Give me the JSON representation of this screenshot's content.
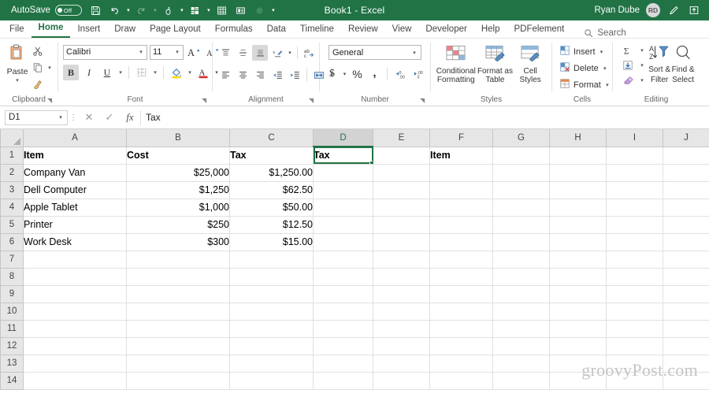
{
  "titlebar": {
    "autosave_label": "AutoSave",
    "autosave_state": "Off",
    "document_title": "Book1  -  Excel",
    "user_name": "Ryan Dube",
    "avatar_initials": "RD",
    "quick_access": [
      {
        "name": "save-icon",
        "label": "Save"
      },
      {
        "name": "undo-icon",
        "label": "Undo"
      },
      {
        "name": "redo-icon",
        "label": "Redo"
      },
      {
        "name": "touch-mode-icon",
        "label": "Touch/Mouse Mode"
      },
      {
        "name": "sort-filter-icon",
        "label": "Sort and Filter"
      },
      {
        "name": "table-icon",
        "label": "Table"
      },
      {
        "name": "form-icon",
        "label": "Form"
      },
      {
        "name": "record-icon",
        "label": "Record"
      },
      {
        "name": "customize-qat-icon",
        "label": "Customize Quick Access Toolbar"
      }
    ],
    "ribbon_display_icon": "ribbon-display-options-icon",
    "pen_icon": "pen-icon"
  },
  "tabs": [
    {
      "label": "File",
      "active": false
    },
    {
      "label": "Home",
      "active": true
    },
    {
      "label": "Insert",
      "active": false
    },
    {
      "label": "Draw",
      "active": false
    },
    {
      "label": "Page Layout",
      "active": false
    },
    {
      "label": "Formulas",
      "active": false
    },
    {
      "label": "Data",
      "active": false
    },
    {
      "label": "Timeline",
      "active": false
    },
    {
      "label": "Review",
      "active": false
    },
    {
      "label": "View",
      "active": false
    },
    {
      "label": "Developer",
      "active": false
    },
    {
      "label": "Help",
      "active": false
    },
    {
      "label": "PDFelement",
      "active": false
    }
  ],
  "search": {
    "placeholder": "Search",
    "label": "Search"
  },
  "ribbon": {
    "clipboard": {
      "group_label": "Clipboard",
      "paste_label": "Paste",
      "cut_label": "Cut",
      "copy_label": "Copy",
      "format_painter_label": "Format Painter"
    },
    "font": {
      "group_label": "Font",
      "font_name": "Calibri",
      "font_size": "11",
      "grow_label": "Increase Font Size",
      "shrink_label": "Decrease Font Size",
      "bold_label": "B",
      "italic_label": "I",
      "underline_label": "U",
      "borders_label": "Borders",
      "fill_label": "Fill Color",
      "fontcolor_label": "Font Color"
    },
    "alignment": {
      "group_label": "Alignment",
      "top_align_label": "Top Align",
      "middle_align_label": "Middle Align",
      "bottom_align_label": "Bottom Align",
      "orientation_label": "Orientation",
      "align_left_label": "Align Left",
      "align_center_label": "Center",
      "align_right_label": "Align Right",
      "decrease_indent_label": "Decrease Indent",
      "increase_indent_label": "Increase Indent",
      "wrap_text_label": "Wrap Text",
      "merge_label": "Merge & Center"
    },
    "number": {
      "group_label": "Number",
      "format_value": "General",
      "currency_label": "$",
      "percent_label": "%",
      "comma_label": ",",
      "increase_decimal_label": "Increase Decimal",
      "decrease_decimal_label": "Decrease Decimal"
    },
    "styles": {
      "group_label": "Styles",
      "conditional_formatting_label": "Conditional Formatting",
      "format_as_table_label": "Format as Table",
      "cell_styles_label": "Cell Styles"
    },
    "cells": {
      "group_label": "Cells",
      "insert_label": "Insert",
      "delete_label": "Delete",
      "format_label": "Format"
    },
    "editing": {
      "group_label": "Editing",
      "autosum_label": "AutoSum",
      "fill_label": "Fill",
      "clear_label": "Clear",
      "sort_filter_label": "Sort &\nFilter",
      "sort_filter_line1": "Sort &",
      "sort_filter_line2": "Filter",
      "find_select_line1": "Find &",
      "find_select_line2": "Select"
    }
  },
  "formula_bar": {
    "name_box_value": "D1",
    "cancel_label": "Cancel",
    "enter_label": "Enter",
    "fx_label": "fx",
    "formula_value": "Tax"
  },
  "grid": {
    "columns": [
      "A",
      "B",
      "C",
      "D",
      "E",
      "F",
      "G",
      "H",
      "I",
      "J"
    ],
    "selected_column": "D",
    "selected_cell": "D1",
    "rows": [
      1,
      2,
      3,
      4,
      5,
      6,
      7,
      8,
      9,
      10,
      11,
      12,
      13,
      14
    ],
    "cells": {
      "A1": "Item",
      "B1": "Cost",
      "C1": "Tax",
      "D1": "Tax",
      "F1": "Item",
      "A2": "Company Van",
      "B2": "$25,000",
      "C2": "$1,250.00",
      "A3": "Dell Computer",
      "B3": "$1,250",
      "C3": "$62.50",
      "A4": "Apple Tablet",
      "B4": "$1,000",
      "C4": "$50.00",
      "A5": "Printer",
      "B5": "$250",
      "C5": "$12.50",
      "A6": "Work Desk",
      "B6": "$300",
      "C6": "$15.00"
    }
  },
  "watermark": "groovyPost.com",
  "colors": {
    "excel_green": "#217346",
    "ribbon_bg": "#ffffff",
    "header_bg": "#e6e6e6",
    "selected_header_bg": "#d3d3d3",
    "grid_line": "#e0e0e0"
  }
}
